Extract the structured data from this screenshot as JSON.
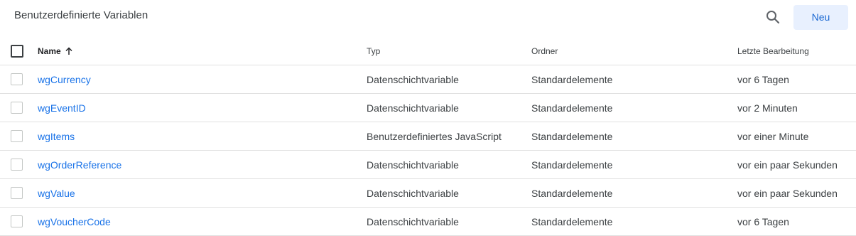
{
  "header": {
    "title": "Benutzerdefinierte Variablen",
    "search_icon": "search-icon",
    "new_label": "Neu"
  },
  "table": {
    "columns": {
      "name": "Name",
      "type": "Typ",
      "folder": "Ordner",
      "last_edit": "Letzte Bearbeitung"
    },
    "sort": {
      "column": "name",
      "direction": "ascending",
      "icon": "arrow-up-icon"
    },
    "rows": [
      {
        "name": "wgCurrency",
        "type": "Datenschichtvariable",
        "folder": "Standardelemente",
        "last_edit": "vor 6 Tagen"
      },
      {
        "name": "wgEventID",
        "type": "Datenschichtvariable",
        "folder": "Standardelemente",
        "last_edit": "vor 2 Minuten"
      },
      {
        "name": "wgItems",
        "type": "Benutzerdefiniertes JavaScript",
        "folder": "Standardelemente",
        "last_edit": "vor einer Minute"
      },
      {
        "name": "wgOrderReference",
        "type": "Datenschichtvariable",
        "folder": "Standardelemente",
        "last_edit": "vor ein paar Sekunden"
      },
      {
        "name": "wgValue",
        "type": "Datenschichtvariable",
        "folder": "Standardelemente",
        "last_edit": "vor ein paar Sekunden"
      },
      {
        "name": "wgVoucherCode",
        "type": "Datenschichtvariable",
        "folder": "Standardelemente",
        "last_edit": "vor 6 Tagen"
      }
    ]
  },
  "colors": {
    "link": "#1a73e8",
    "button_bg": "#e8f0fe",
    "button_text": "#1967d2",
    "divider": "#e0e0e0"
  }
}
